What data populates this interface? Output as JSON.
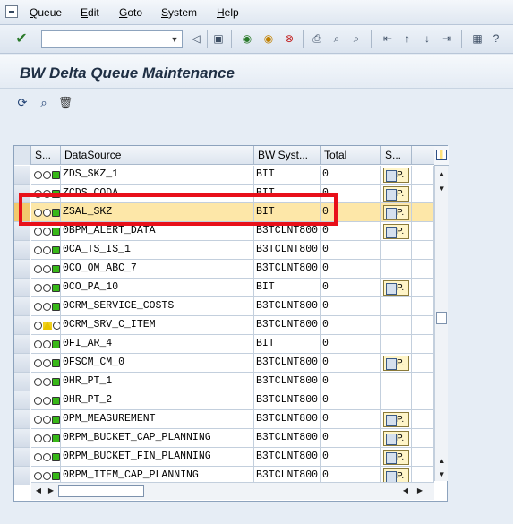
{
  "menu": {
    "items": [
      {
        "label": "Queue",
        "ul": "Q",
        "rest": "ueue"
      },
      {
        "label": "Edit",
        "ul": "E",
        "rest": "dit"
      },
      {
        "label": "Goto",
        "ul": "G",
        "rest": "oto"
      },
      {
        "label": "System",
        "ul": "S",
        "rest": "ystem"
      },
      {
        "label": "Help",
        "ul": "H",
        "rest": "elp"
      }
    ]
  },
  "toolbar": {
    "command_field_value": "",
    "icons": [
      "enter-icon",
      "back-icon",
      "save-icon",
      "back-green-icon",
      "exit-icon",
      "cancel-icon",
      "print-icon",
      "find-icon",
      "find-next-icon",
      "first-page-icon",
      "previous-page-icon",
      "next-page-icon",
      "last-page-icon",
      "layout-icon",
      "help-icon"
    ]
  },
  "page": {
    "title": "BW Delta Queue Maintenance"
  },
  "app_toolbar": {
    "icons": [
      "refresh-icon",
      "display-entries-icon",
      "delete-icon"
    ]
  },
  "grid": {
    "headers": {
      "status": "S...",
      "datasource": "DataSource",
      "bw_system": "BW Syst...",
      "total": "Total",
      "stat": "S..."
    },
    "stat_button_label": "P.",
    "rows": [
      {
        "status": "green",
        "datasource": "ZDS_SKZ_1",
        "bw_system": "BIT",
        "total": "0",
        "stat": true
      },
      {
        "status": "green",
        "datasource": "ZCDS_CODA",
        "bw_system": "BIT",
        "total": "0",
        "stat": true
      },
      {
        "status": "green",
        "datasource": "ZSAL_SKZ",
        "bw_system": "BIT",
        "total": "0",
        "stat": true
      },
      {
        "status": "green",
        "datasource": "0BPM_ALERT_DATA",
        "bw_system": "B3TCLNT800",
        "total": "0",
        "stat": true
      },
      {
        "status": "green",
        "datasource": "0CA_TS_IS_1",
        "bw_system": "B3TCLNT800",
        "total": "0",
        "stat": false
      },
      {
        "status": "green",
        "datasource": "0CO_OM_ABC_7",
        "bw_system": "B3TCLNT800",
        "total": "0",
        "stat": false
      },
      {
        "status": "green",
        "datasource": "0CO_PA_10",
        "bw_system": "BIT",
        "total": "0",
        "stat": true
      },
      {
        "status": "green",
        "datasource": "0CRM_SERVICE_COSTS",
        "bw_system": "B3TCLNT800",
        "total": "0",
        "stat": false
      },
      {
        "status": "yellow",
        "datasource": "0CRM_SRV_C_ITEM",
        "bw_system": "B3TCLNT800",
        "total": "0",
        "stat": false
      },
      {
        "status": "green",
        "datasource": "0FI_AR_4",
        "bw_system": "BIT",
        "total": "0",
        "stat": false
      },
      {
        "status": "green",
        "datasource": "0FSCM_CM_0",
        "bw_system": "B3TCLNT800",
        "total": "0",
        "stat": true
      },
      {
        "status": "green",
        "datasource": "0HR_PT_1",
        "bw_system": "B3TCLNT800",
        "total": "0",
        "stat": false
      },
      {
        "status": "green",
        "datasource": "0HR_PT_2",
        "bw_system": "B3TCLNT800",
        "total": "0",
        "stat": false
      },
      {
        "status": "green",
        "datasource": "0PM_MEASUREMENT",
        "bw_system": "B3TCLNT800",
        "total": "0",
        "stat": true
      },
      {
        "status": "green",
        "datasource": "0RPM_BUCKET_CAP_PLANNING",
        "bw_system": "B3TCLNT800",
        "total": "0",
        "stat": true
      },
      {
        "status": "green",
        "datasource": "0RPM_BUCKET_FIN_PLANNING",
        "bw_system": "B3TCLNT800",
        "total": "0",
        "stat": true
      },
      {
        "status": "green",
        "datasource": "0RPM_ITEM_CAP_PLANNING",
        "bw_system": "B3TCLNT800",
        "total": "0",
        "stat": true
      }
    ],
    "selected_row": "ZSAL_SKZ"
  },
  "colors": {
    "highlight_row": "#fde7a8",
    "annotation_box": "#e8101a",
    "status_green": "#38b818",
    "status_yellow": "#e8c400"
  }
}
